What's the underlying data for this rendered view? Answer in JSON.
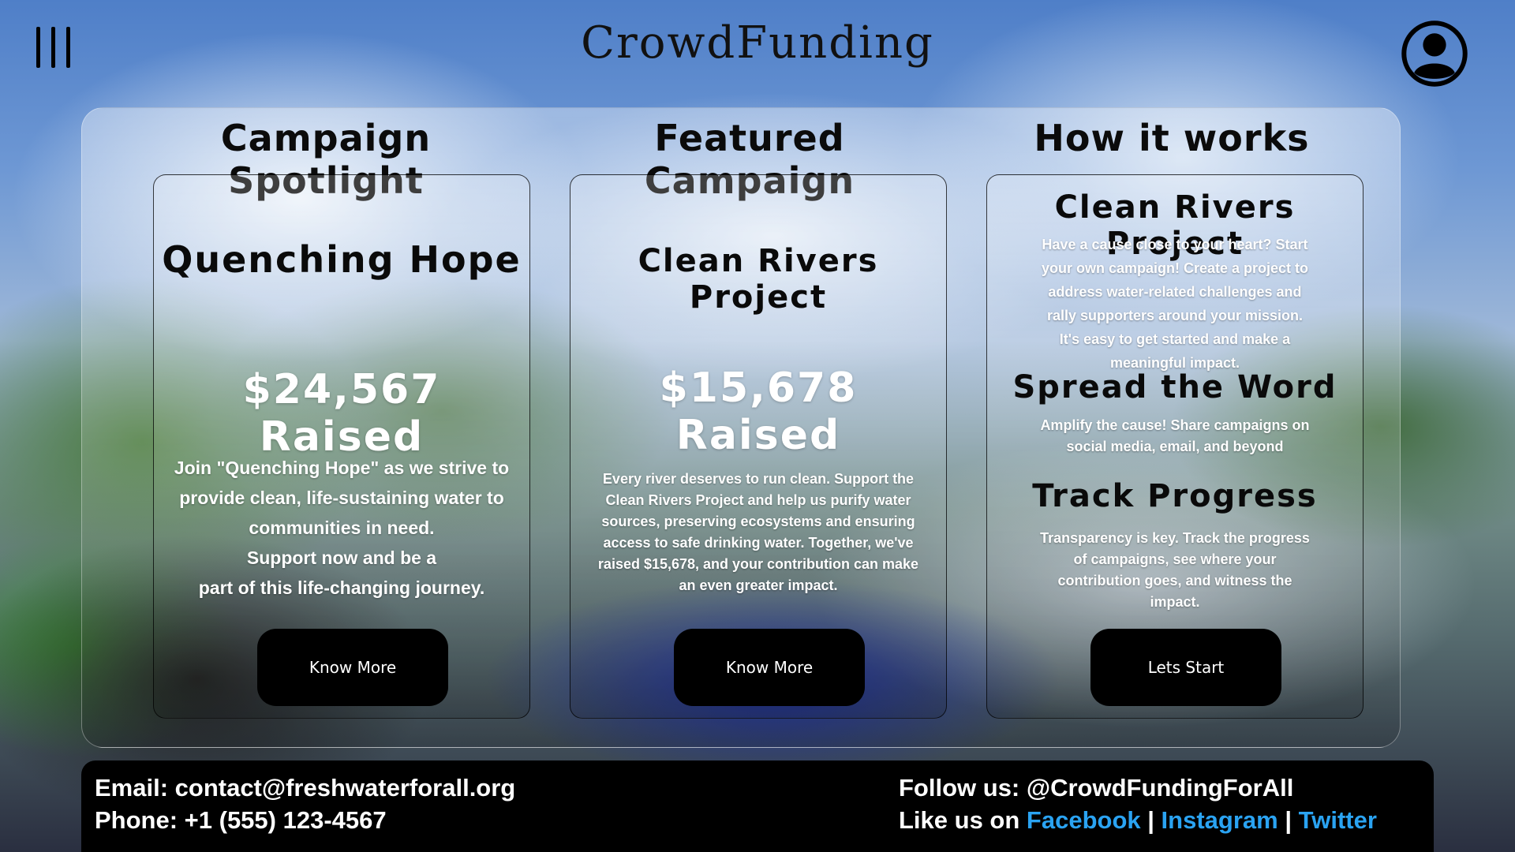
{
  "header": {
    "logo": "CrowdFunding",
    "menu_icon": "menu-bars-icon",
    "profile_icon": "user-circle-icon"
  },
  "columns": [
    {
      "heading": "Campaign Spotlight",
      "card": {
        "title": "Quenching Hope",
        "raised": "$24,567 Raised",
        "description_lines": [
          "Join \"Quenching Hope\" as we strive to",
          "provide clean, life-sustaining water to",
          "communities in need.",
          "Support now and be a",
          "part of this life-changing journey."
        ],
        "button": "Know More"
      }
    },
    {
      "heading": "Featured Campaign",
      "card": {
        "title": "Clean Rivers Project",
        "raised": "$15,678 Raised",
        "description_lines": [
          "Every river deserves to run clean. Support the",
          "Clean Rivers Project and help us purify water",
          "sources, preserving ecosystems and ensuring",
          "access to safe drinking water. Together, we've",
          "raised $15,678, and your contribution can make",
          "an even greater impact."
        ],
        "button": "Know More"
      }
    },
    {
      "heading": "How it works",
      "card": {
        "sections": [
          {
            "title": "Clean Rivers Project",
            "lines": [
              "Have a cause close to your heart? Start",
              "your own campaign! Create a project to",
              "address water-related challenges and",
              "rally supporters around your mission.",
              "It's easy to get started and make a",
              "meaningful impact."
            ]
          },
          {
            "title": "Spread the Word",
            "lines": [
              "Amplify the cause! Share campaigns on",
              "social media, email, and beyond"
            ]
          },
          {
            "title": "Track Progress",
            "lines": [
              "Transparency is key. Track the progress",
              "of campaigns, see where your",
              "contribution goes, and witness the",
              "impact."
            ]
          }
        ],
        "button": "Lets Start"
      }
    }
  ],
  "footer": {
    "email": "Email: contact@freshwaterforall.org",
    "phone": "Phone: +1 (555) 123-4567",
    "follow": "Follow us: @CrowdFundingForAll",
    "like_prefix": "Like us on ",
    "links": [
      "Facebook",
      "Instagram",
      "Twitter"
    ],
    "separator": " | ",
    "link_color": "#2aa3f2"
  }
}
